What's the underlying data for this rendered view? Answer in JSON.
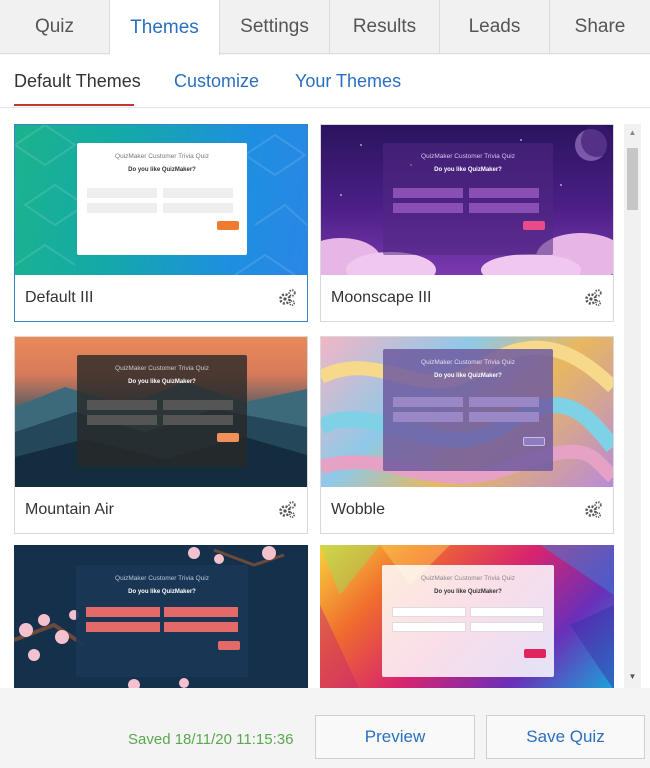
{
  "top_tabs": [
    "Quiz",
    "Themes",
    "Settings",
    "Results",
    "Leads",
    "Share"
  ],
  "sub_tabs": {
    "default": "Default Themes",
    "customize": "Customize",
    "yours": "Your Themes"
  },
  "preview_text": {
    "title": "QuizMaker Customer Trivia Quiz",
    "question": "Do you like QuizMaker?"
  },
  "themes": [
    {
      "name": "Default III"
    },
    {
      "name": "Moonscape III"
    },
    {
      "name": "Mountain Air"
    },
    {
      "name": "Wobble"
    }
  ],
  "footer": {
    "saved": "Saved 18/11/20 11:15:36",
    "preview": "Preview",
    "save": "Save Quiz"
  },
  "icons": {
    "settings": "gears-icon",
    "scroll_up": "triangle-up-icon",
    "scroll_down": "triangle-down-icon"
  },
  "colors": {
    "accent_blue": "#2a6fbf",
    "active_underline": "#c0392b",
    "saved_green": "#5aa84e"
  }
}
